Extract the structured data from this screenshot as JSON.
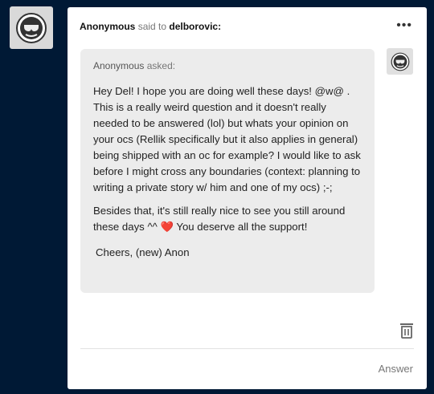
{
  "post": {
    "asker_name": "Anonymous",
    "said_to": "said to",
    "recipient": "delborovic:",
    "more_label": "•••"
  },
  "ask": {
    "asker": "Anonymous",
    "asked_label": "asked:",
    "paragraph_1": "Hey Del! I hope you are doing well these days! @w@ . This is a really weird question and it doesn't really needed to be answered (lol) but whats your opinion on your ocs (Rellik specifically but it also applies in general) being shipped with an oc for example? I would like to ask before I might cross any boundaries (context: planning to writing a private story w/ him and one of my ocs) ;-;",
    "paragraph_2_pre": "Besides that, it's still really nice to see you still around these days ^^",
    "heart": "❤️",
    "paragraph_2_post": "You deserve all the support!",
    "signoff": "Cheers, (new) Anon"
  },
  "actions": {
    "answer_label": "Answer"
  },
  "icons": {
    "avatar": "anonymous-sunglasses-icon",
    "trash": "trash-icon",
    "more": "ellipsis-icon"
  },
  "colors": {
    "background": "#001935",
    "card": "#ffffff",
    "bubble": "#ececec"
  }
}
